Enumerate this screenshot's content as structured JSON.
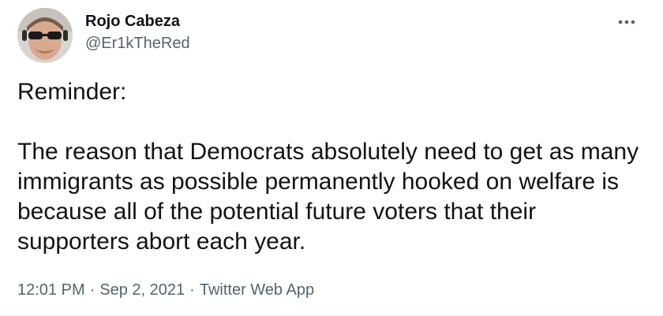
{
  "author": {
    "display_name": "Rojo Cabeza",
    "handle": "@Er1kTheRed"
  },
  "icons": {
    "avatar": "avatar-icon",
    "more": "more-horizontal-icon"
  },
  "tweet": {
    "lines": [
      "Reminder:",
      "The reason that Democrats absolutely need to get as many immigrants as possible permanently hooked on welfare is because all of the potential future voters that their supporters abort each year."
    ]
  },
  "meta": {
    "time": "12:01 PM",
    "separator": "·",
    "date": "Sep 2, 2021",
    "source": "Twitter Web App"
  },
  "colors": {
    "text_primary": "#0f1419",
    "text_secondary": "#536471"
  }
}
